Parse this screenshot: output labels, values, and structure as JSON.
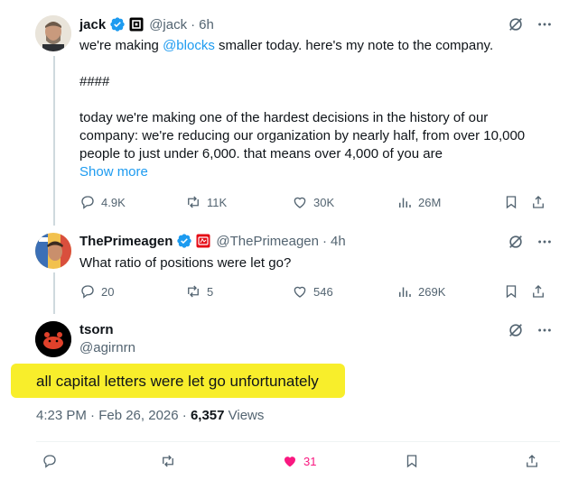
{
  "tweets": [
    {
      "name": "jack",
      "handle": "@jack",
      "time": "6h",
      "text_before": "we're making ",
      "mention": "@blocks",
      "text_after": " smaller today. here's my note to the company.\n\n####\n\ntoday we're making one of the hardest decisions in the history of our company: we're reducing our organization by nearly half, from over 10,000 people to just under 6,000. that means over 4,000 of you are",
      "show_more": "Show more",
      "replies": "4.9K",
      "reposts": "11K",
      "likes": "30K",
      "views": "26M"
    },
    {
      "name": "ThePrimeagen",
      "handle": "@ThePrimeagen",
      "time": "4h",
      "text": "What ratio of positions were let go?",
      "replies": "20",
      "reposts": "5",
      "likes": "546",
      "views": "269K"
    },
    {
      "name": "tsorn",
      "handle": "@agirnrn",
      "text": "all capital letters were let go unfortunately",
      "timestamp": "4:23 PM · Feb 26, 2026 · ",
      "view_count": "6,357",
      "views_label": " Views",
      "likes": "31"
    }
  ],
  "colors": {
    "accent": "#1d9bf0",
    "like_active": "#f91880",
    "highlight": "#f8ee2b",
    "muted": "#536471"
  },
  "separators": {
    "dot": "·"
  }
}
